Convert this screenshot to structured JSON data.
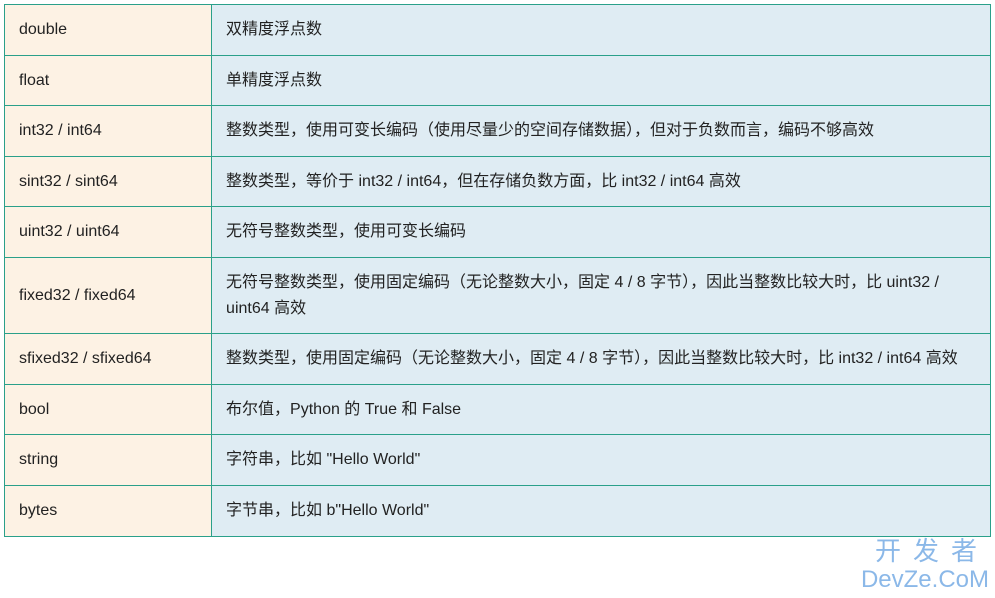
{
  "rows": [
    {
      "type": "double",
      "desc": "双精度浮点数"
    },
    {
      "type": "float",
      "desc": "单精度浮点数"
    },
    {
      "type": "int32 / int64",
      "desc": "整数类型，使用可变长编码（使用尽量少的空间存储数据），但对于负数而言，编码不够高效"
    },
    {
      "type": "sint32 / sint64",
      "desc": "整数类型，等价于 int32 / int64，但在存储负数方面，比 int32 / int64 高效"
    },
    {
      "type": "uint32 / uint64",
      "desc": "无符号整数类型，使用可变长编码"
    },
    {
      "type": "fixed32 / fixed64",
      "desc": "无符号整数类型，使用固定编码（无论整数大小，固定 4 / 8 字节），因此当整数比较大时，比 uint32 / uint64 高效"
    },
    {
      "type": "sfixed32 / sfixed64",
      "desc": "整数类型，使用固定编码（无论整数大小，固定 4 / 8 字节），因此当整数比较大时，比 int32 / int64 高效"
    },
    {
      "type": "bool",
      "desc": "布尔值，Python 的 True 和 False"
    },
    {
      "type": "string",
      "desc": "字符串，比如 \"Hello World\""
    },
    {
      "type": "bytes",
      "desc": "字节串，比如 b\"Hello World\""
    }
  ],
  "watermark": {
    "cn": "开发者",
    "en": "DevZe.CoM"
  }
}
